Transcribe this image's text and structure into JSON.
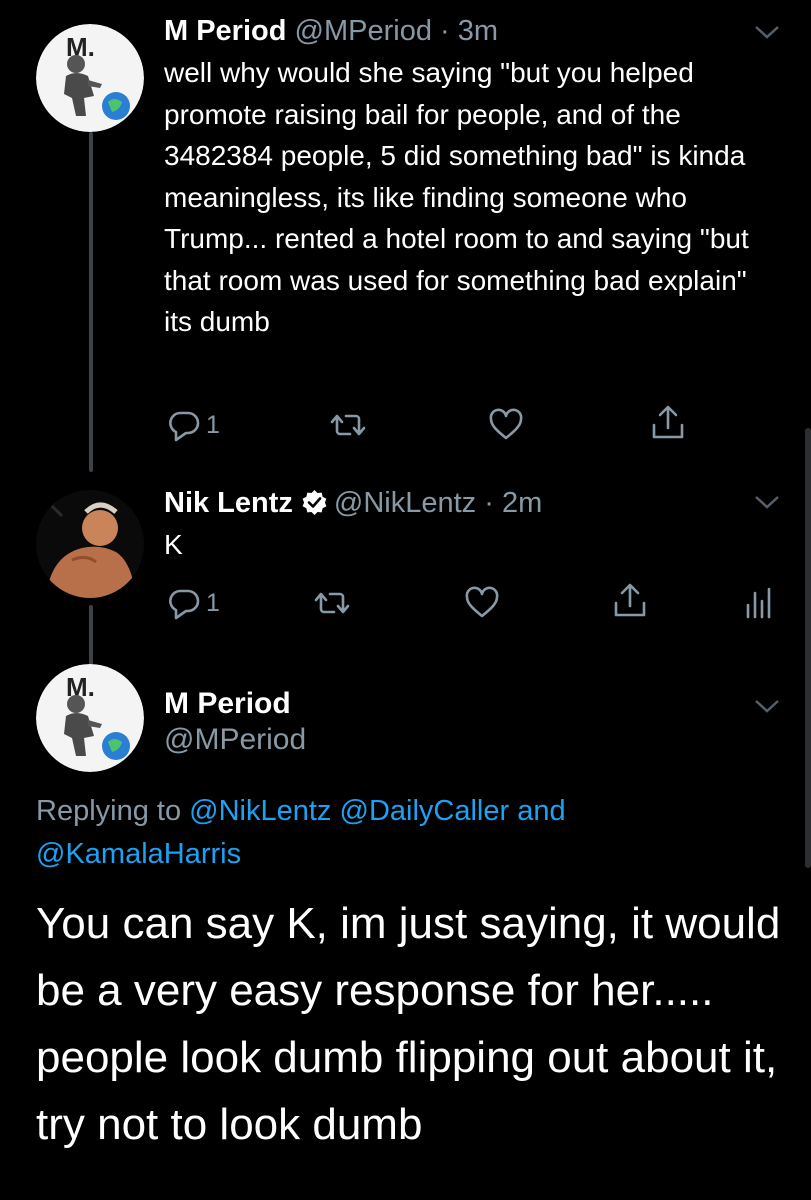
{
  "tweets": [
    {
      "name": "M Period",
      "handle": "@MPeriod",
      "time": "· 3m",
      "text": "well why would she saying \"but you helped promote raising bail for people, and of the 3482384 people, 5 did something bad\" is kinda meaningless, its like finding someone who Trump... rented a hotel room to and saying \"but that room was used for something bad explain\" its dumb",
      "reply_count": "1"
    },
    {
      "name": "Nik Lentz",
      "handle": "@NikLentz",
      "time": "· 2m",
      "text": "K",
      "reply_count": "1"
    }
  ],
  "main_tweet": {
    "name": "M Period",
    "handle": "@MPeriod",
    "replying_prefix": "Replying to",
    "mention_1": "@NikLentz",
    "mention_2": "@DailyCaller",
    "and_word": "and",
    "mention_3": "@KamalaHarris",
    "text": "You can say K, im just saying, it would be a very easy response for her..... people look dumb flipping out about it, try not to look dumb"
  },
  "avatar_logo_text": "M.",
  "colors": {
    "background": "#000000",
    "text": "#ffffff",
    "muted": "#8899a6",
    "link": "#1da1f2",
    "thread_line": "#3d4248"
  },
  "icons": [
    "reply-icon",
    "retweet-icon",
    "like-icon",
    "share-icon",
    "analytics-icon",
    "verified-badge-icon",
    "chevron-down-icon"
  ]
}
